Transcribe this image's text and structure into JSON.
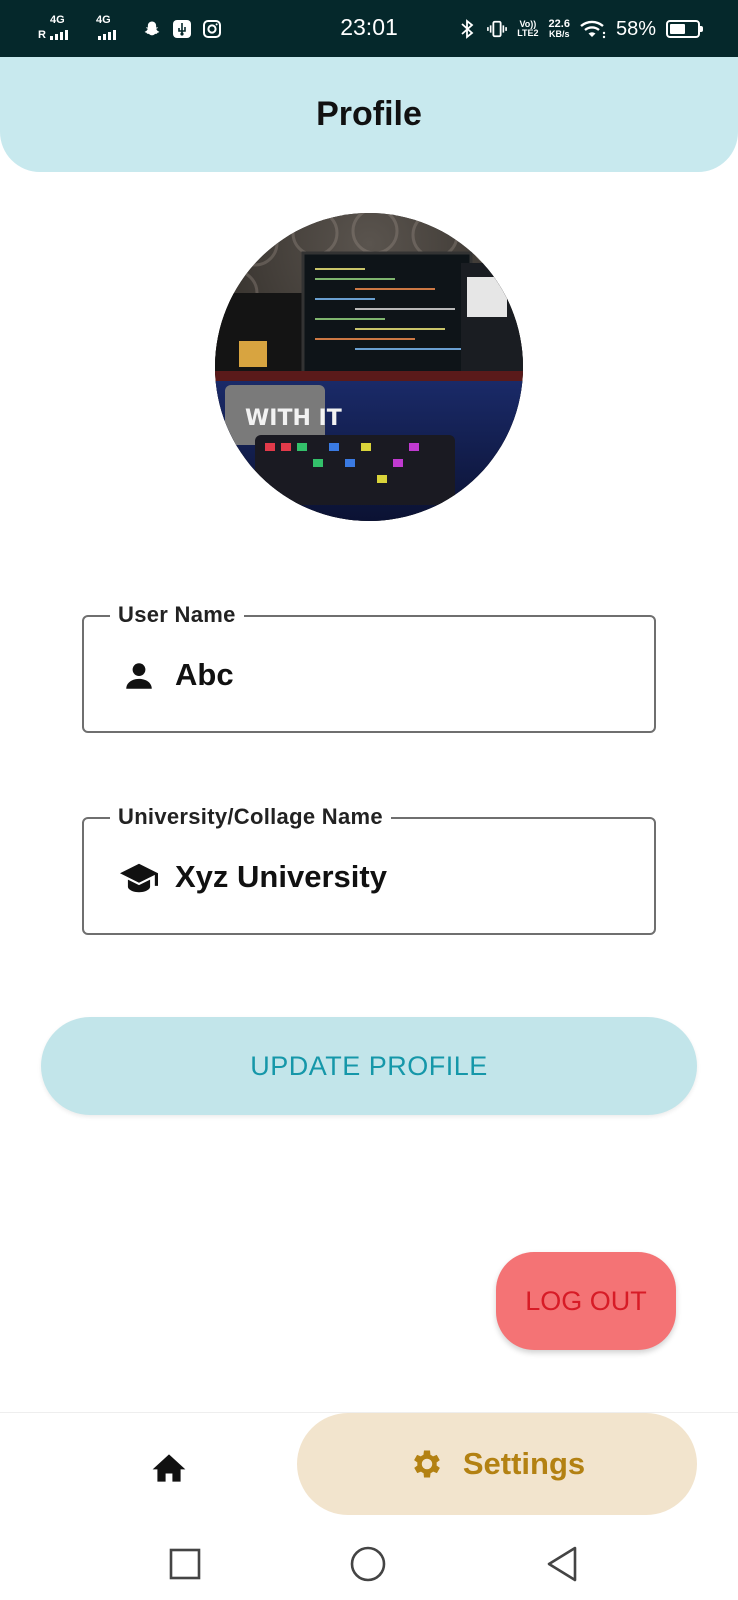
{
  "status_bar": {
    "time": "23:01",
    "signal1_label": "4G",
    "signal1_roaming": "R",
    "signal2_label": "4G",
    "volte_line1": "Vo))",
    "volte_line2": "LTE2",
    "net_speed_value": "22.6",
    "net_speed_unit": "KB/s",
    "battery_percent": "58%",
    "battery_level": 0.58
  },
  "header": {
    "title": "Profile"
  },
  "avatar": {
    "alt": "profile photo"
  },
  "form": {
    "user_name": {
      "label": "User Name",
      "value": "Abc",
      "icon": "person-icon"
    },
    "university": {
      "label": "University/Collage Name",
      "value": "Xyz University",
      "icon": "graduation-cap-icon"
    }
  },
  "buttons": {
    "update_profile": "UPDATE PROFILE",
    "log_out": "LOG OUT"
  },
  "bottom_nav": {
    "home_icon": "home-icon",
    "settings_label": "Settings",
    "settings_icon": "gear-icon"
  },
  "colors": {
    "status_bar_bg": "#05282b",
    "header_bg": "#c8e9ee",
    "update_bg": "#c2e5ea",
    "update_text": "#1597a9",
    "logout_bg": "#f47375",
    "logout_text": "#d71b26",
    "settings_bg": "#f2e4cd",
    "settings_text": "#b38112"
  }
}
